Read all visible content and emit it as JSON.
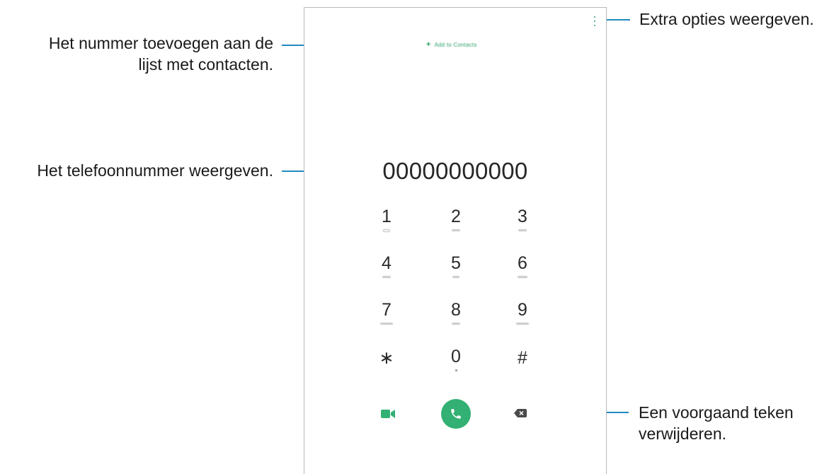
{
  "dialer": {
    "add_to_contacts": "Add to Contacts",
    "add_plus": "+",
    "phone_number": "00000000000",
    "keys": [
      {
        "digit": "1",
        "sub": "voicemail"
      },
      {
        "digit": "2",
        "sub": "ABC"
      },
      {
        "digit": "3",
        "sub": "DEF"
      },
      {
        "digit": "4",
        "sub": "GHI"
      },
      {
        "digit": "5",
        "sub": "JKL"
      },
      {
        "digit": "6",
        "sub": "MNO"
      },
      {
        "digit": "7",
        "sub": "PQRS"
      },
      {
        "digit": "8",
        "sub": "TUV"
      },
      {
        "digit": "9",
        "sub": "WXYZ"
      },
      {
        "digit": "∗",
        "sub": ""
      },
      {
        "digit": "0",
        "sub": "+"
      },
      {
        "digit": "#",
        "sub": ""
      }
    ],
    "icons": {
      "more": "more-options-icon",
      "video": "video-call-icon",
      "call": "phone-call-icon",
      "backspace": "backspace-icon"
    },
    "colors": {
      "accent": "#33b073",
      "callout_line": "#1f8ac0"
    }
  },
  "callouts": {
    "add_contact": [
      "Het nummer toevoegen aan de",
      "lijst met contacten."
    ],
    "phone_number": "Het telefoonnummer weergeven.",
    "more_options": "Extra opties weergeven.",
    "backspace": [
      "Een voorgaand teken",
      "verwijderen."
    ]
  }
}
